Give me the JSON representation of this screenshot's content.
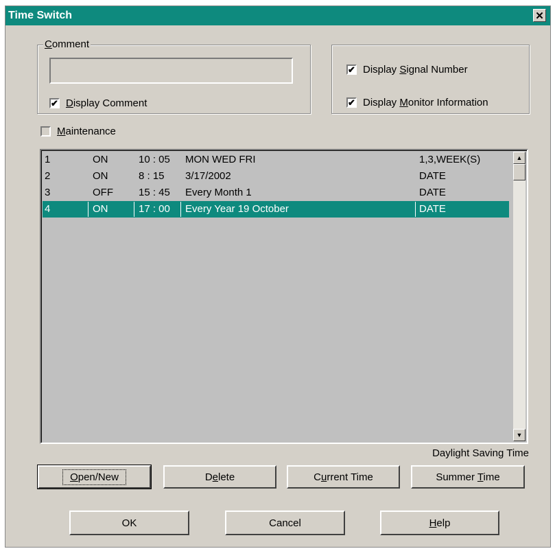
{
  "window": {
    "title": "Time Switch",
    "close_glyph": "✕"
  },
  "comment_group": {
    "legend": "Comment",
    "value": "",
    "display_comment_label": "Display Comment",
    "display_comment_checked": true
  },
  "options_group": {
    "display_signal_number_label": "Display Signal Number",
    "display_signal_number_checked": true,
    "display_monitor_info_label": "Display Monitor Information",
    "display_monitor_info_checked": true
  },
  "maintenance": {
    "label": "Maintenance",
    "checked": false
  },
  "schedule": [
    {
      "no": "1",
      "state": "ON",
      "time": "10 : 05",
      "when": "MON WED FRI",
      "type": "1,3,WEEK(S)",
      "selected": false
    },
    {
      "no": "2",
      "state": "ON",
      "time": "8 : 15",
      "when": "3/17/2002",
      "type": "DATE",
      "selected": false
    },
    {
      "no": "3",
      "state": "OFF",
      "time": "15 : 45",
      "when": "Every Month  1",
      "type": "DATE",
      "selected": false
    },
    {
      "no": "4",
      "state": "ON",
      "time": "17 : 00",
      "when": "Every Year  19  October",
      "type": "DATE",
      "selected": true
    }
  ],
  "daylight_label": "Daylight Saving Time",
  "buttons": {
    "open_new": "Open/New",
    "delete": "Delete",
    "current_time": "Current Time",
    "summer_time": "Summer Time",
    "ok": "OK",
    "cancel": "Cancel",
    "help": "Help"
  },
  "colors": {
    "accent": "#0e8a7e",
    "face": "#d4d0c8",
    "list_bg": "#c0c0c0"
  }
}
